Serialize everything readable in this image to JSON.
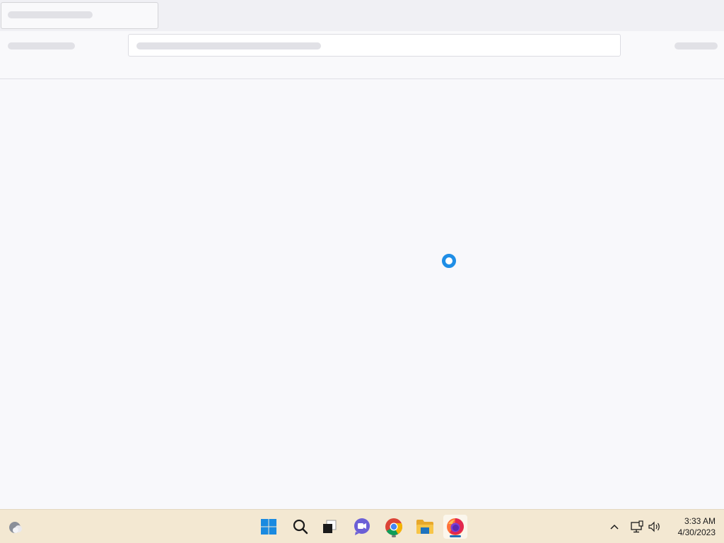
{
  "browser": {
    "state": "loading"
  },
  "taskbar": {
    "apps": [
      {
        "name": "weather-widget",
        "icon": "weather-icon"
      },
      {
        "name": "start",
        "icon": "windows-start-icon"
      },
      {
        "name": "search",
        "icon": "search-icon"
      },
      {
        "name": "task-view",
        "icon": "task-view-icon"
      },
      {
        "name": "teams-chat",
        "icon": "chat-icon"
      },
      {
        "name": "chrome",
        "icon": "chrome-icon"
      },
      {
        "name": "file-explorer",
        "icon": "folder-icon"
      },
      {
        "name": "firefox",
        "icon": "firefox-icon",
        "active": true
      }
    ],
    "tray": {
      "time": "3:33 AM",
      "date": "4/30/2023"
    }
  },
  "colors": {
    "accent": "#1f8ee6",
    "taskbar_bg": "#f3e8d2"
  }
}
